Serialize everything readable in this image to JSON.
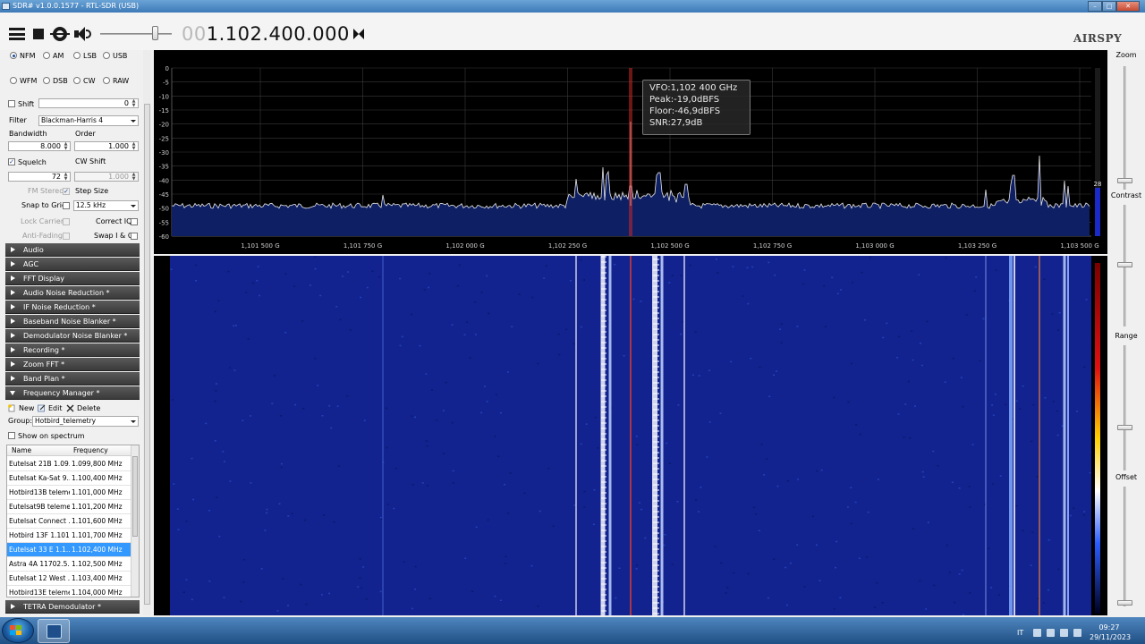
{
  "window": {
    "title": "SDR# v1.0.0.1577 - RTL-SDR (USB)",
    "buttons": {
      "minimize": "–",
      "maximize": "□",
      "close": "✕"
    }
  },
  "toolbar": {
    "menu_icon": "hamburger-menu-icon",
    "stop_icon": "stop-icon",
    "settings_icon": "gear-icon",
    "audio_icon": "speaker-icon",
    "volume_level": 0.8,
    "frequency_leading": "00",
    "frequency_main": "1.102.400.000",
    "tune_icon": "step-tune-icon",
    "logo": "AIRSPY"
  },
  "modes": [
    "NFM",
    "AM",
    "LSB",
    "USB",
    "WFM",
    "DSB",
    "CW",
    "RAW"
  ],
  "selected_mode": "NFM",
  "radio": {
    "shift_label": "Shift",
    "shift_value": "0",
    "filter_label": "Filter",
    "filter_value": "Blackman-Harris 4",
    "bandwidth_label": "Bandwidth",
    "bandwidth_value": "8.000",
    "order_label": "Order",
    "order_value": "1.000",
    "squelch_label": "Squelch",
    "squelch_value": "72",
    "cwshift_label": "CW Shift",
    "cwshift_value": "1.000",
    "fmstereo_label": "FM Stereo",
    "stepsize_label": "Step Size",
    "snap_label": "Snap to Grid",
    "step_value": "12.5 kHz",
    "lockcarrier_label": "Lock Carrier",
    "correctiq_label": "Correct IQ",
    "antifading_label": "Anti-Fading",
    "swapiq_label": "Swap I & Q"
  },
  "panels": [
    "Audio",
    "AGC",
    "FFT Display",
    "Audio Noise Reduction *",
    "IF Noise Reduction *",
    "Baseband Noise Blanker *",
    "Demodulator Noise Blanker *",
    "Recording *",
    "Zoom FFT *",
    "Band Plan *",
    "Frequency Manager *"
  ],
  "frequency_manager": {
    "new_label": "New",
    "edit_label": "Edit",
    "delete_label": "Delete",
    "group_label": "Group:",
    "group_value": "Hotbird_telemetry",
    "show_on_spectrum_label": "Show on spectrum",
    "columns": [
      "Name",
      "Frequency"
    ],
    "rows": [
      {
        "name": "Eutelsat 21B 1.09...",
        "freq": "1.099,800 MHz"
      },
      {
        "name": "Eutelsat Ka-Sat 9...",
        "freq": "1.100,400 MHz"
      },
      {
        "name": "Hotbird13B teleme...",
        "freq": "1.101,000 MHz"
      },
      {
        "name": "Eutelsat9B teleme...",
        "freq": "1.101,200 MHz"
      },
      {
        "name": "Eutelsat Connect ...",
        "freq": "1.101,600 MHz"
      },
      {
        "name": "Hotbird 13F 1.101...",
        "freq": "1.101,700 MHz"
      },
      {
        "name": "Eutelsat 33  E 1.1...",
        "freq": "1.102,400 MHz"
      },
      {
        "name": "Astra 4A 11702.5...",
        "freq": "1.102,500 MHz"
      },
      {
        "name": "Eutelsat 12 West ...",
        "freq": "1.103,400 MHz"
      },
      {
        "name": "Hotbird13E teleme...",
        "freq": "1.104,000 MHz"
      }
    ],
    "selected_row": 6
  },
  "tetra_panel": "TETRA Demodulator *",
  "spectrum": {
    "y_ticks": [
      "0",
      "-5",
      "-10",
      "-15",
      "-20",
      "-25",
      "-30",
      "-35",
      "-40",
      "-45",
      "-50",
      "-55",
      "-60"
    ],
    "x_ticks": [
      "1,101 500 G",
      "1,101 750 G",
      "1,102 000 G",
      "1,102 250 G",
      "1,102 500 G",
      "1,102 750 G",
      "1,103 000 G",
      "1,103 250 G",
      "1,103 500 G"
    ],
    "level_value": "28",
    "tooltip": {
      "vfo": "VFO:1,102 400 GHz",
      "peak": "Peak:-19,0dBFS",
      "floor": "Floor:-46,9dBFS",
      "snr": "SNR:27,9dB"
    }
  },
  "right_controls": {
    "zoom_label": "Zoom",
    "contrast_label": "Contrast",
    "range_label": "Range",
    "offset_label": "Offset"
  },
  "taskbar": {
    "lang": "IT",
    "time": "09:27",
    "date": "29/11/2023"
  },
  "colors": {
    "spectrum_bg": "#000000",
    "spectrum_fill": "#0f1f63",
    "vfo_line": "#c0392b",
    "waterfall_bg": "#0a1a7a",
    "selection": "#3399ff"
  }
}
